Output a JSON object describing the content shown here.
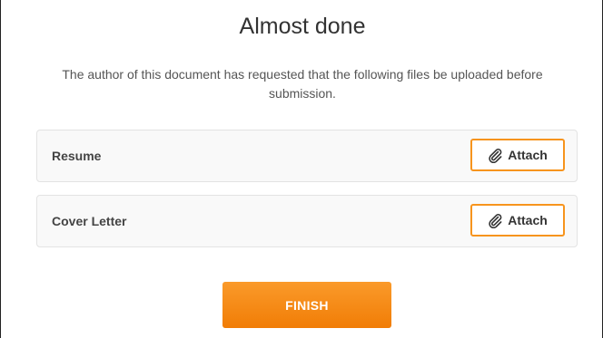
{
  "dialog": {
    "title": "Almost done",
    "description": "The author of this document has requested that the following files be uploaded before submission."
  },
  "files": [
    {
      "label": "Resume",
      "attach_label": "Attach",
      "icon": "paperclip-icon"
    },
    {
      "label": "Cover Letter",
      "attach_label": "Attach",
      "icon": "paperclip-icon"
    }
  ],
  "finish_label": "FINISH",
  "colors": {
    "accent": "#f7941d",
    "finish_top": "#fa9a2a",
    "finish_bottom": "#f17d06"
  }
}
